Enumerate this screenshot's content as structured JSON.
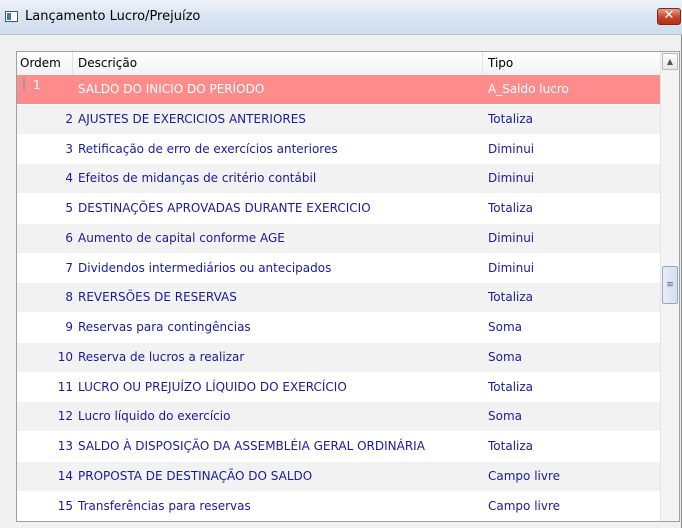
{
  "window": {
    "title": "Lançamento Lucro/Prejuízo",
    "close_glyph": "✕"
  },
  "icons": {
    "app": "window-app-icon",
    "close": "close-icon"
  },
  "grid": {
    "columns": [
      "Ordem",
      "Descrição",
      "Tipo"
    ],
    "rows": [
      {
        "ordem": "1",
        "descricao": "SALDO DO INICIO DO PERÍODO",
        "tipo": "A_Saldo lucro"
      },
      {
        "ordem": "2",
        "descricao": "AJUSTES DE EXERCICIOS ANTERIORES",
        "tipo": "Totaliza"
      },
      {
        "ordem": "3",
        "descricao": "Retificação de erro de exercícios anteriores",
        "tipo": "Diminui"
      },
      {
        "ordem": "4",
        "descricao": "Efeitos de midanças de critério contábil",
        "tipo": "Diminui"
      },
      {
        "ordem": "5",
        "descricao": "DESTINAÇÕES APROVADAS DURANTE EXERCICIO",
        "tipo": "Totaliza"
      },
      {
        "ordem": "6",
        "descricao": "Aumento de capital conforme AGE",
        "tipo": "Diminui"
      },
      {
        "ordem": "7",
        "descricao": "Dividendos intermediários ou antecipados",
        "tipo": "Diminui"
      },
      {
        "ordem": "8",
        "descricao": "REVERSÕES DE RESERVAS",
        "tipo": "Totaliza"
      },
      {
        "ordem": "9",
        "descricao": "Reservas para contingências",
        "tipo": "Soma"
      },
      {
        "ordem": "10",
        "descricao": "Reserva de lucros a realizar",
        "tipo": "Soma"
      },
      {
        "ordem": "11",
        "descricao": "LUCRO OU PREJUÍZO LÍQUIDO DO EXERCÍCIO",
        "tipo": "Totaliza"
      },
      {
        "ordem": "12",
        "descricao": "Lucro líquido do exercício",
        "tipo": "Soma"
      },
      {
        "ordem": "13",
        "descricao": "SALDO À DISPOSIÇÃO DA ASSEMBLÉIA GERAL ORDINÁRIA",
        "tipo": "Totaliza"
      },
      {
        "ordem": "14",
        "descricao": "PROPOSTA DE DESTINAÇÃO DO SALDO",
        "tipo": "Campo livre"
      },
      {
        "ordem": "15",
        "descricao": "Transferências para reservas",
        "tipo": "Campo livre"
      }
    ],
    "selected_index": 0,
    "colors": {
      "selected_row": "#ff8c8c",
      "row_text": "#1b1b9a",
      "alt_row": "#f2f2f2"
    }
  },
  "scrollbar": {
    "up_glyph": "▲",
    "thumb_glyph": "≡"
  }
}
